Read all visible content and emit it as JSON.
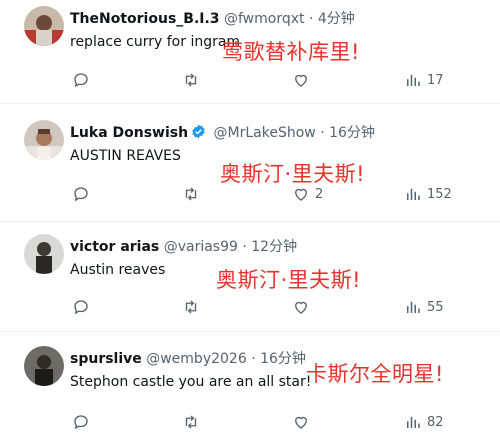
{
  "tweets": [
    {
      "name": "TheNotorious_B.I.3",
      "handle": "@fwmorqxt",
      "dot": "·",
      "time": "4分钟",
      "text": "replace curry for ingram",
      "overlay": "莺歌替补库里!",
      "verified": false,
      "replies": "",
      "retweets": "",
      "likes": "",
      "views": "17"
    },
    {
      "name": "Luka Donswish",
      "handle": "@MrLakeShow",
      "dot": "·",
      "time": "16分钟",
      "text": "AUSTIN REAVES",
      "overlay": "奥斯汀·里夫斯!",
      "verified": true,
      "replies": "",
      "retweets": "",
      "likes": "2",
      "views": "152"
    },
    {
      "name": "victor arias",
      "handle": "@varias99",
      "dot": "·",
      "time": "12分钟",
      "text": "Austin reaves",
      "overlay": "奥斯汀·里夫斯!",
      "verified": false,
      "replies": "",
      "retweets": "",
      "likes": "",
      "views": "55"
    },
    {
      "name": "spurslive",
      "handle": "@wemby2026",
      "dot": "·",
      "time": "16分钟",
      "text": "Stephon castle you are an all star!",
      "overlay": "卡斯尔全明星!",
      "verified": false,
      "replies": "",
      "retweets": "",
      "likes": "",
      "views": "82"
    }
  ],
  "colors": {
    "overlay_red": "#e8322b",
    "verified_blue": "#1d9bf0",
    "muted": "#536471",
    "divider": "#eff3f4"
  },
  "icons": [
    "reply-icon",
    "retweet-icon",
    "like-icon",
    "views-icon",
    "verified-badge-icon"
  ]
}
